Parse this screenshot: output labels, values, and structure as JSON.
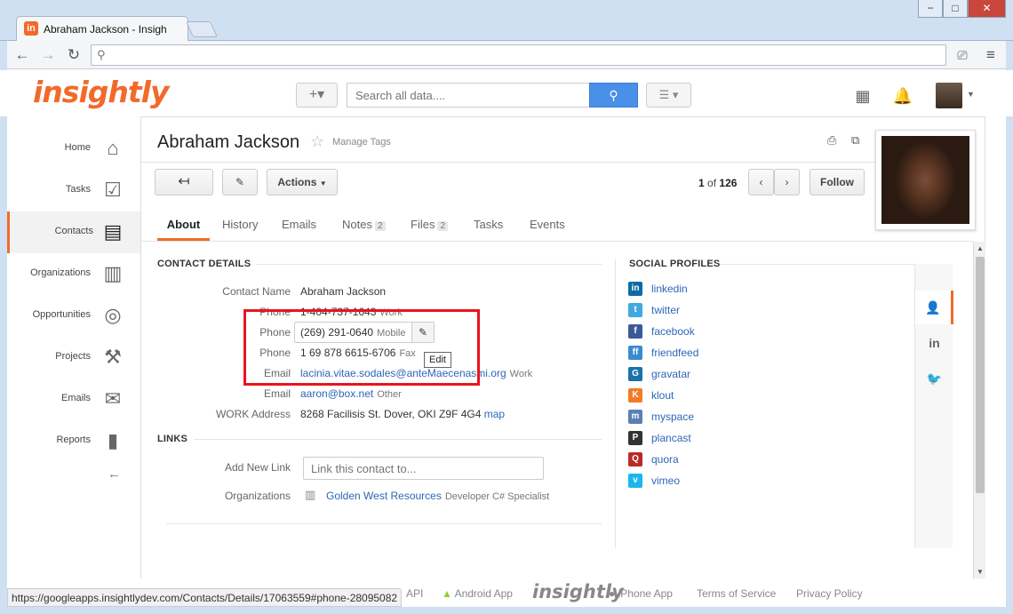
{
  "browser": {
    "tab_title": "Abraham Jackson - Insigh",
    "tab_favicon": "in",
    "window_controls": [
      "−",
      "□",
      "✕"
    ],
    "url": "",
    "status_url": "https://googleapps.insightlydev.com/Contacts/Details/17063559#phone-28095082"
  },
  "header": {
    "logo": "insightly",
    "search_placeholder": "Search all data....",
    "add_button": "+▾",
    "icons": [
      "calendar-icon",
      "bell-icon"
    ]
  },
  "sidebar": {
    "items": [
      {
        "label": "Home",
        "icon": "house-icon"
      },
      {
        "label": "Tasks",
        "icon": "checkbox-icon"
      },
      {
        "label": "Contacts",
        "icon": "contact-card-icon",
        "active": true
      },
      {
        "label": "Organizations",
        "icon": "building-icon"
      },
      {
        "label": "Opportunities",
        "icon": "target-icon"
      },
      {
        "label": "Projects",
        "icon": "hammer-icon"
      },
      {
        "label": "Emails",
        "icon": "envelope-icon"
      },
      {
        "label": "Reports",
        "icon": "bar-chart-icon"
      }
    ]
  },
  "contact": {
    "name": "Abraham Jackson",
    "manage_tags": "Manage Tags",
    "actions_label": "Actions",
    "pager_current": "1",
    "pager_of": "of",
    "pager_total": "126",
    "follow_label": "Follow"
  },
  "tabs": [
    {
      "label": "About",
      "active": true
    },
    {
      "label": "History"
    },
    {
      "label": "Emails"
    },
    {
      "label": "Notes",
      "badge": "2"
    },
    {
      "label": "Files",
      "badge": "2"
    },
    {
      "label": "Tasks"
    },
    {
      "label": "Events"
    }
  ],
  "details": {
    "section_title": "CONTACT DETAILS",
    "contact_name_label": "Contact Name",
    "contact_name_value": "Abraham Jackson",
    "phone_label": "Phone",
    "phone_work_value": "1-404-737-1643",
    "phone_work_type": "Work",
    "phone_mobile_value": "(269) 291-0640",
    "phone_mobile_type": "Mobile",
    "phone_fax_value": "1 69 878 6615-6706",
    "phone_fax_type": "Fax",
    "email_label": "Email",
    "email1_value": "lacinia.vitae.sodales@anteMaecenasmi.org",
    "email1_type": "Work",
    "email2_value": "aaron@box.net",
    "email2_type": "Other",
    "address_label": "WORK Address",
    "address_value": "8268 Facilisis St. Dover, OKI Z9F 4G4",
    "map_link": "map",
    "edit_tooltip": "Edit"
  },
  "links": {
    "section_title": "LINKS",
    "add_label": "Add New Link",
    "add_placeholder": "Link this contact to...",
    "org_label": "Organizations",
    "org_name": "Golden West Resources",
    "org_role": "Developer C# Specialist"
  },
  "social": {
    "section_title": "SOCIAL PROFILES",
    "profiles": [
      {
        "name": "linkedin",
        "icon": "in",
        "color": "#0e6aa6"
      },
      {
        "name": "twitter",
        "icon": "t",
        "color": "#3fa9e0"
      },
      {
        "name": "facebook",
        "icon": "f",
        "color": "#3b5a9a"
      },
      {
        "name": "friendfeed",
        "icon": "ff",
        "color": "#3a8ad0"
      },
      {
        "name": "gravatar",
        "icon": "G",
        "color": "#1a73a8"
      },
      {
        "name": "klout",
        "icon": "K",
        "color": "#f27b2a"
      },
      {
        "name": "myspace",
        "icon": "m",
        "color": "#5b7fb4"
      },
      {
        "name": "plancast",
        "icon": "P",
        "color": "#333333"
      },
      {
        "name": "quora",
        "icon": "Q",
        "color": "#b92b27"
      },
      {
        "name": "vimeo",
        "icon": "v",
        "color": "#1ab7ea"
      }
    ]
  },
  "footer": {
    "api": "API",
    "android": "Android App",
    "logo": "insightly",
    "iphone": "iPhone App",
    "terms": "Terms of Service",
    "privacy": "Privacy Policy"
  },
  "colors": {
    "brand_orange": "#f26a2b",
    "link_blue": "#2c67b8",
    "search_blue": "#4a8fe8",
    "highlight_red": "#e8141e"
  }
}
